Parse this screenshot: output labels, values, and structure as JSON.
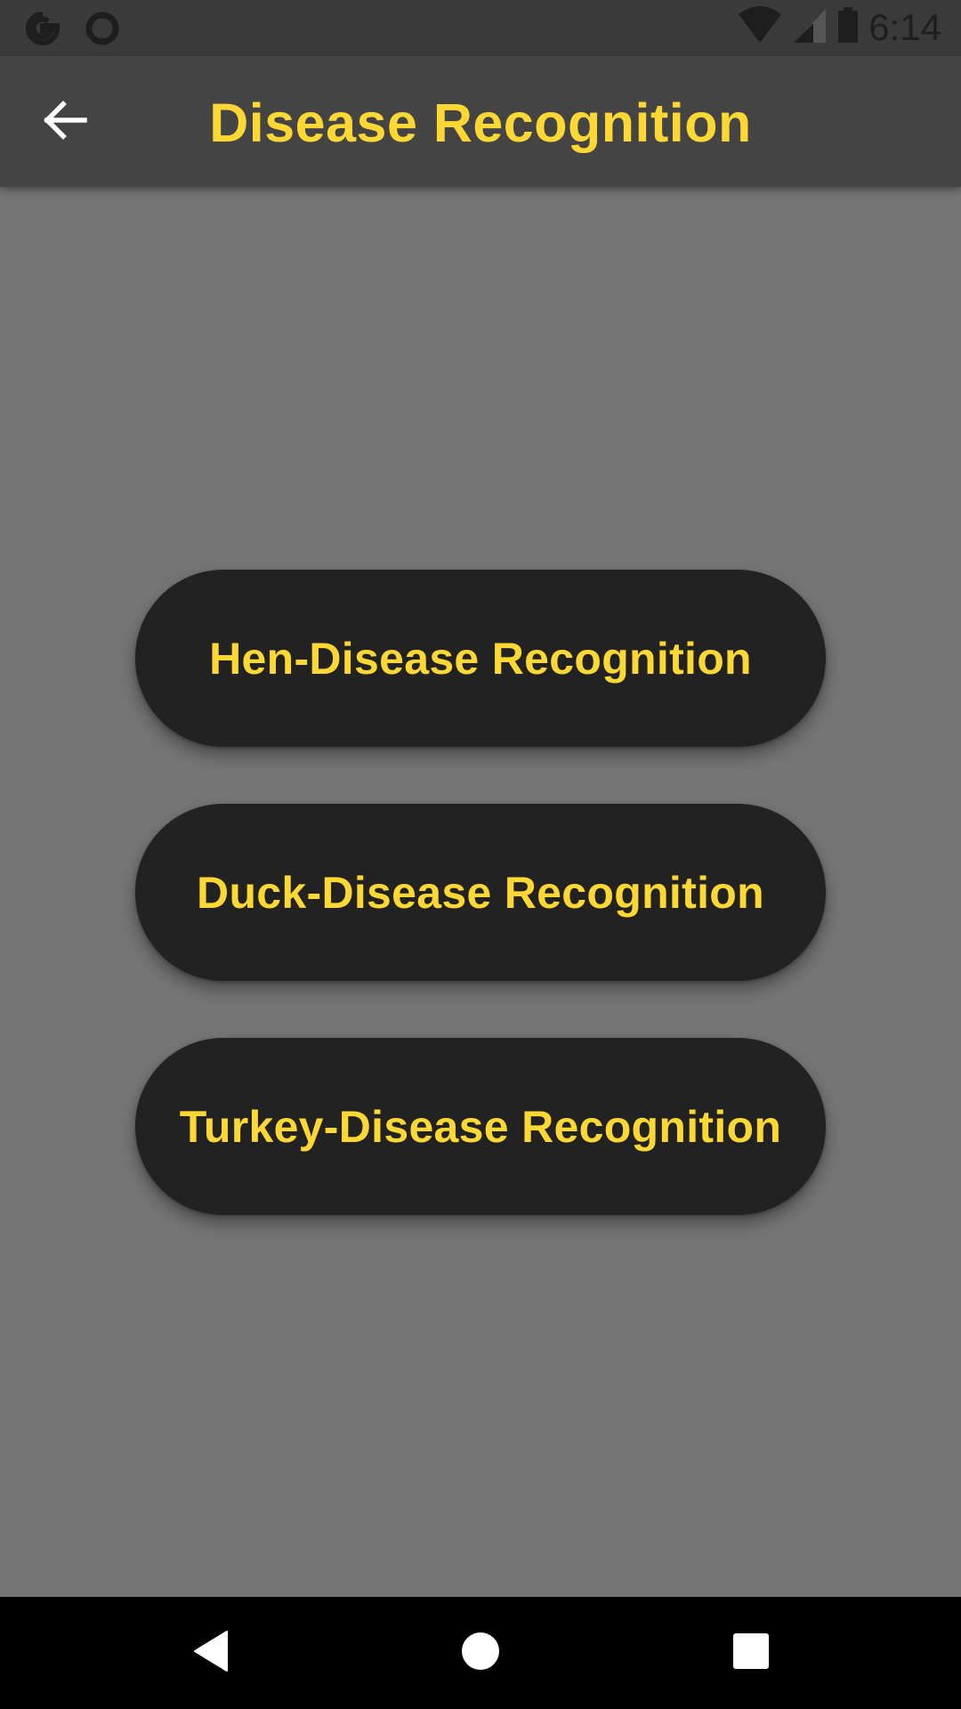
{
  "status_bar": {
    "time": "6:14",
    "left_icons": [
      "google-icon",
      "circle-notification-icon"
    ],
    "right_icons": [
      "wifi-icon",
      "signal-icon",
      "battery-icon"
    ]
  },
  "app_bar": {
    "title": "Disease Recognition",
    "back_icon": "arrow-left-icon"
  },
  "buttons": {
    "hen": "Hen-Disease Recognition",
    "duck": "Duck-Disease Recognition",
    "turkey": "Turkey-Disease Recognition"
  },
  "nav_bar": {
    "icons": [
      "nav-back-icon",
      "nav-home-icon",
      "nav-recents-icon"
    ]
  },
  "colors": {
    "accent": "#fdd835",
    "background": "#757575",
    "app_bar": "#444444",
    "button": "#222222"
  }
}
